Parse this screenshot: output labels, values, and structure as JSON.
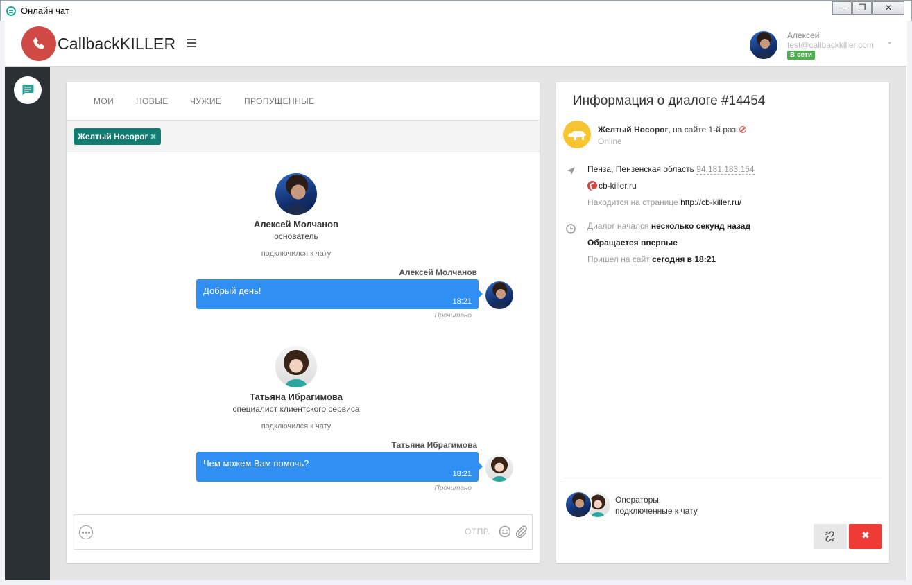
{
  "window": {
    "title": "Онлайн чат",
    "minimize_glyph": "—",
    "restore_glyph": "❐",
    "close_glyph": "✕"
  },
  "header": {
    "logo_text": "CallbackKILLER",
    "user": {
      "name": "Алексей",
      "email": "test@callbackkiller.com",
      "status": "В сети"
    }
  },
  "tabs": [
    "МОИ",
    "НОВЫЕ",
    "ЧУЖИЕ",
    "ПРОПУЩЕННЫЕ"
  ],
  "filter": {
    "chip_label": "Желтый Носорог",
    "chip_remove": "✖"
  },
  "chat": {
    "joins": [
      {
        "name": "Алексей Молчанов",
        "role": "основатель",
        "note": "подключился к чату"
      },
      {
        "name": "Татьяна Ибрагимова",
        "role": "специалист клиентского сервиса",
        "note": "подключился к чату"
      }
    ],
    "messages": [
      {
        "author": "Алексей Молчанов",
        "text": "Добрый день!",
        "time": "18:21",
        "read": "Прочитано"
      },
      {
        "author": "Татьяна Ибрагимова",
        "text": "Чем можем Вам помочь?",
        "time": "18:21",
        "read": "Прочитано"
      }
    ],
    "composer": {
      "placeholder": "",
      "send_label": "ОТПР."
    }
  },
  "info": {
    "title": "Информация о диалоге #14454",
    "visitor": {
      "name": "Желтый Носорог",
      "visits": ", на сайте 1-й раз",
      "status": "Online"
    },
    "location": {
      "region": "Пенза, Пензенская область",
      "ip": "94.181.183.154",
      "site": "cb-killer.ru",
      "page_label": "Находится на странице",
      "page_url": "http://cb-killer.ru/"
    },
    "dialog": {
      "started_label": "Диалог начался",
      "started_value": "несколько секунд назад",
      "first_time": "Обращается впервые",
      "arrived_label": "Пришел на сайт",
      "arrived_value": "сегодня в 18:21"
    },
    "operators_label_1": "Операторы,",
    "operators_label_2": "подключенные к чату",
    "close_glyph": "✖"
  },
  "colors": {
    "brand_red": "#cf4a45",
    "bubble_blue": "#2f8ff3",
    "chip_teal": "#127d70",
    "status_green": "#4cae4c",
    "close_red": "#ef3b35",
    "rail_dark": "#2b3035",
    "visitor_yellow": "#f7c531"
  },
  "icons": [
    "chat-icon",
    "phone-icon",
    "hamburger-icon",
    "chevron-down-icon",
    "location-arrow-icon",
    "clock-icon",
    "unlink-icon",
    "close-icon",
    "emoji-icon",
    "paperclip-icon",
    "more-icon",
    "ban-icon",
    "rhino-icon"
  ]
}
